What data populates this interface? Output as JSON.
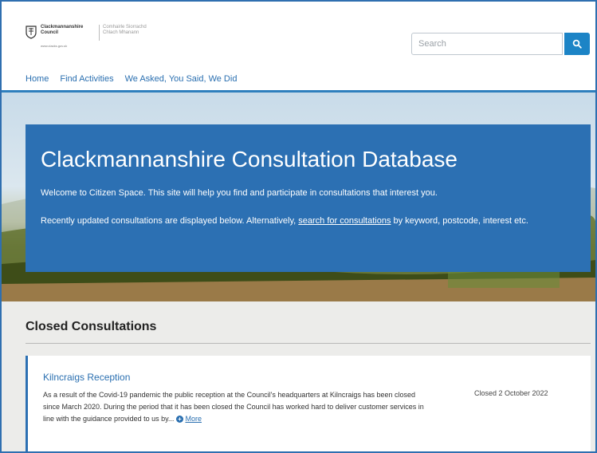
{
  "header": {
    "logo": {
      "name_line1": "Clackmannanshire",
      "name_line2": "Council",
      "tagline_line1": "Comhairle Siorrachd",
      "tagline_line2": "Chlach Mhanann",
      "url": "www.clacks.gov.uk"
    },
    "search": {
      "placeholder": "Search",
      "button_icon": "search-icon"
    },
    "nav": [
      {
        "label": "Home"
      },
      {
        "label": "Find Activities"
      },
      {
        "label": "We Asked, You Said, We Did"
      }
    ]
  },
  "hero": {
    "title": "Clackmannanshire Consultation Database",
    "intro": "Welcome to Citizen Space. This site will help you find and participate in consultations that interest you.",
    "para_before_link": "Recently updated consultations are displayed below. Alternatively, ",
    "link_text": "search for consultations",
    "para_after_link": " by keyword, postcode, interest etc."
  },
  "closed_section": {
    "title": "Closed Consultations",
    "items": [
      {
        "title": "Kilncraigs Reception",
        "description": "As a result of the Covid-19 pandemic the public reception at the Council's headquarters at Kilncraigs has been closed since March 2020. During the period that it has been closed the Council has worked hard to deliver customer services in line with the guidance provided to us by...",
        "more_label": "More",
        "status": "Closed 2 October 2022"
      }
    ]
  },
  "colors": {
    "accent": "#2c70b3",
    "link": "#2a6fb0",
    "search_button": "#1c84c6",
    "page_bg": "#ececea"
  }
}
